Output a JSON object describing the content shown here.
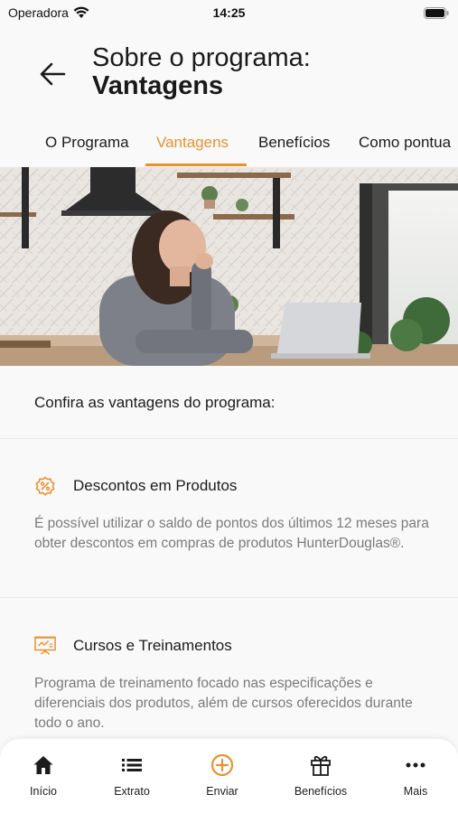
{
  "status_bar": {
    "carrier": "Operadora",
    "time": "14:25"
  },
  "header": {
    "title_line1": "Sobre o programa:",
    "title_line2": "Vantagens"
  },
  "tabs": [
    {
      "label": "O Programa",
      "active": false
    },
    {
      "label": "Vantagens",
      "active": true
    },
    {
      "label": "Benefícios",
      "active": false
    },
    {
      "label": "Como pontua"
    }
  ],
  "intro": "Confira as vantagens do programa:",
  "sections": [
    {
      "icon": "percent-badge-icon",
      "title": "Descontos em Produtos",
      "text": "É possível utilizar o saldo de pontos dos últimos 12 meses para obter descontos em compras de produtos HunterDouglas®."
    },
    {
      "icon": "presentation-board-icon",
      "title": "Cursos e Treinamentos",
      "text": "Programa de treinamento focado nas especificações e diferenciais dos produtos, além de cursos oferecidos durante todo o ano."
    }
  ],
  "bottom_nav": [
    {
      "label": "Início",
      "icon": "home-icon"
    },
    {
      "label": "Extrato",
      "icon": "list-icon"
    },
    {
      "label": "Enviar",
      "icon": "add-circle-icon"
    },
    {
      "label": "Benefícios",
      "icon": "gift-icon"
    },
    {
      "label": "Mais",
      "icon": "more-icon"
    }
  ],
  "colors": {
    "accent": "#e8912e",
    "text": "#1c1c1c",
    "muted": "#7b7b7b",
    "background": "#f9f9f9"
  }
}
